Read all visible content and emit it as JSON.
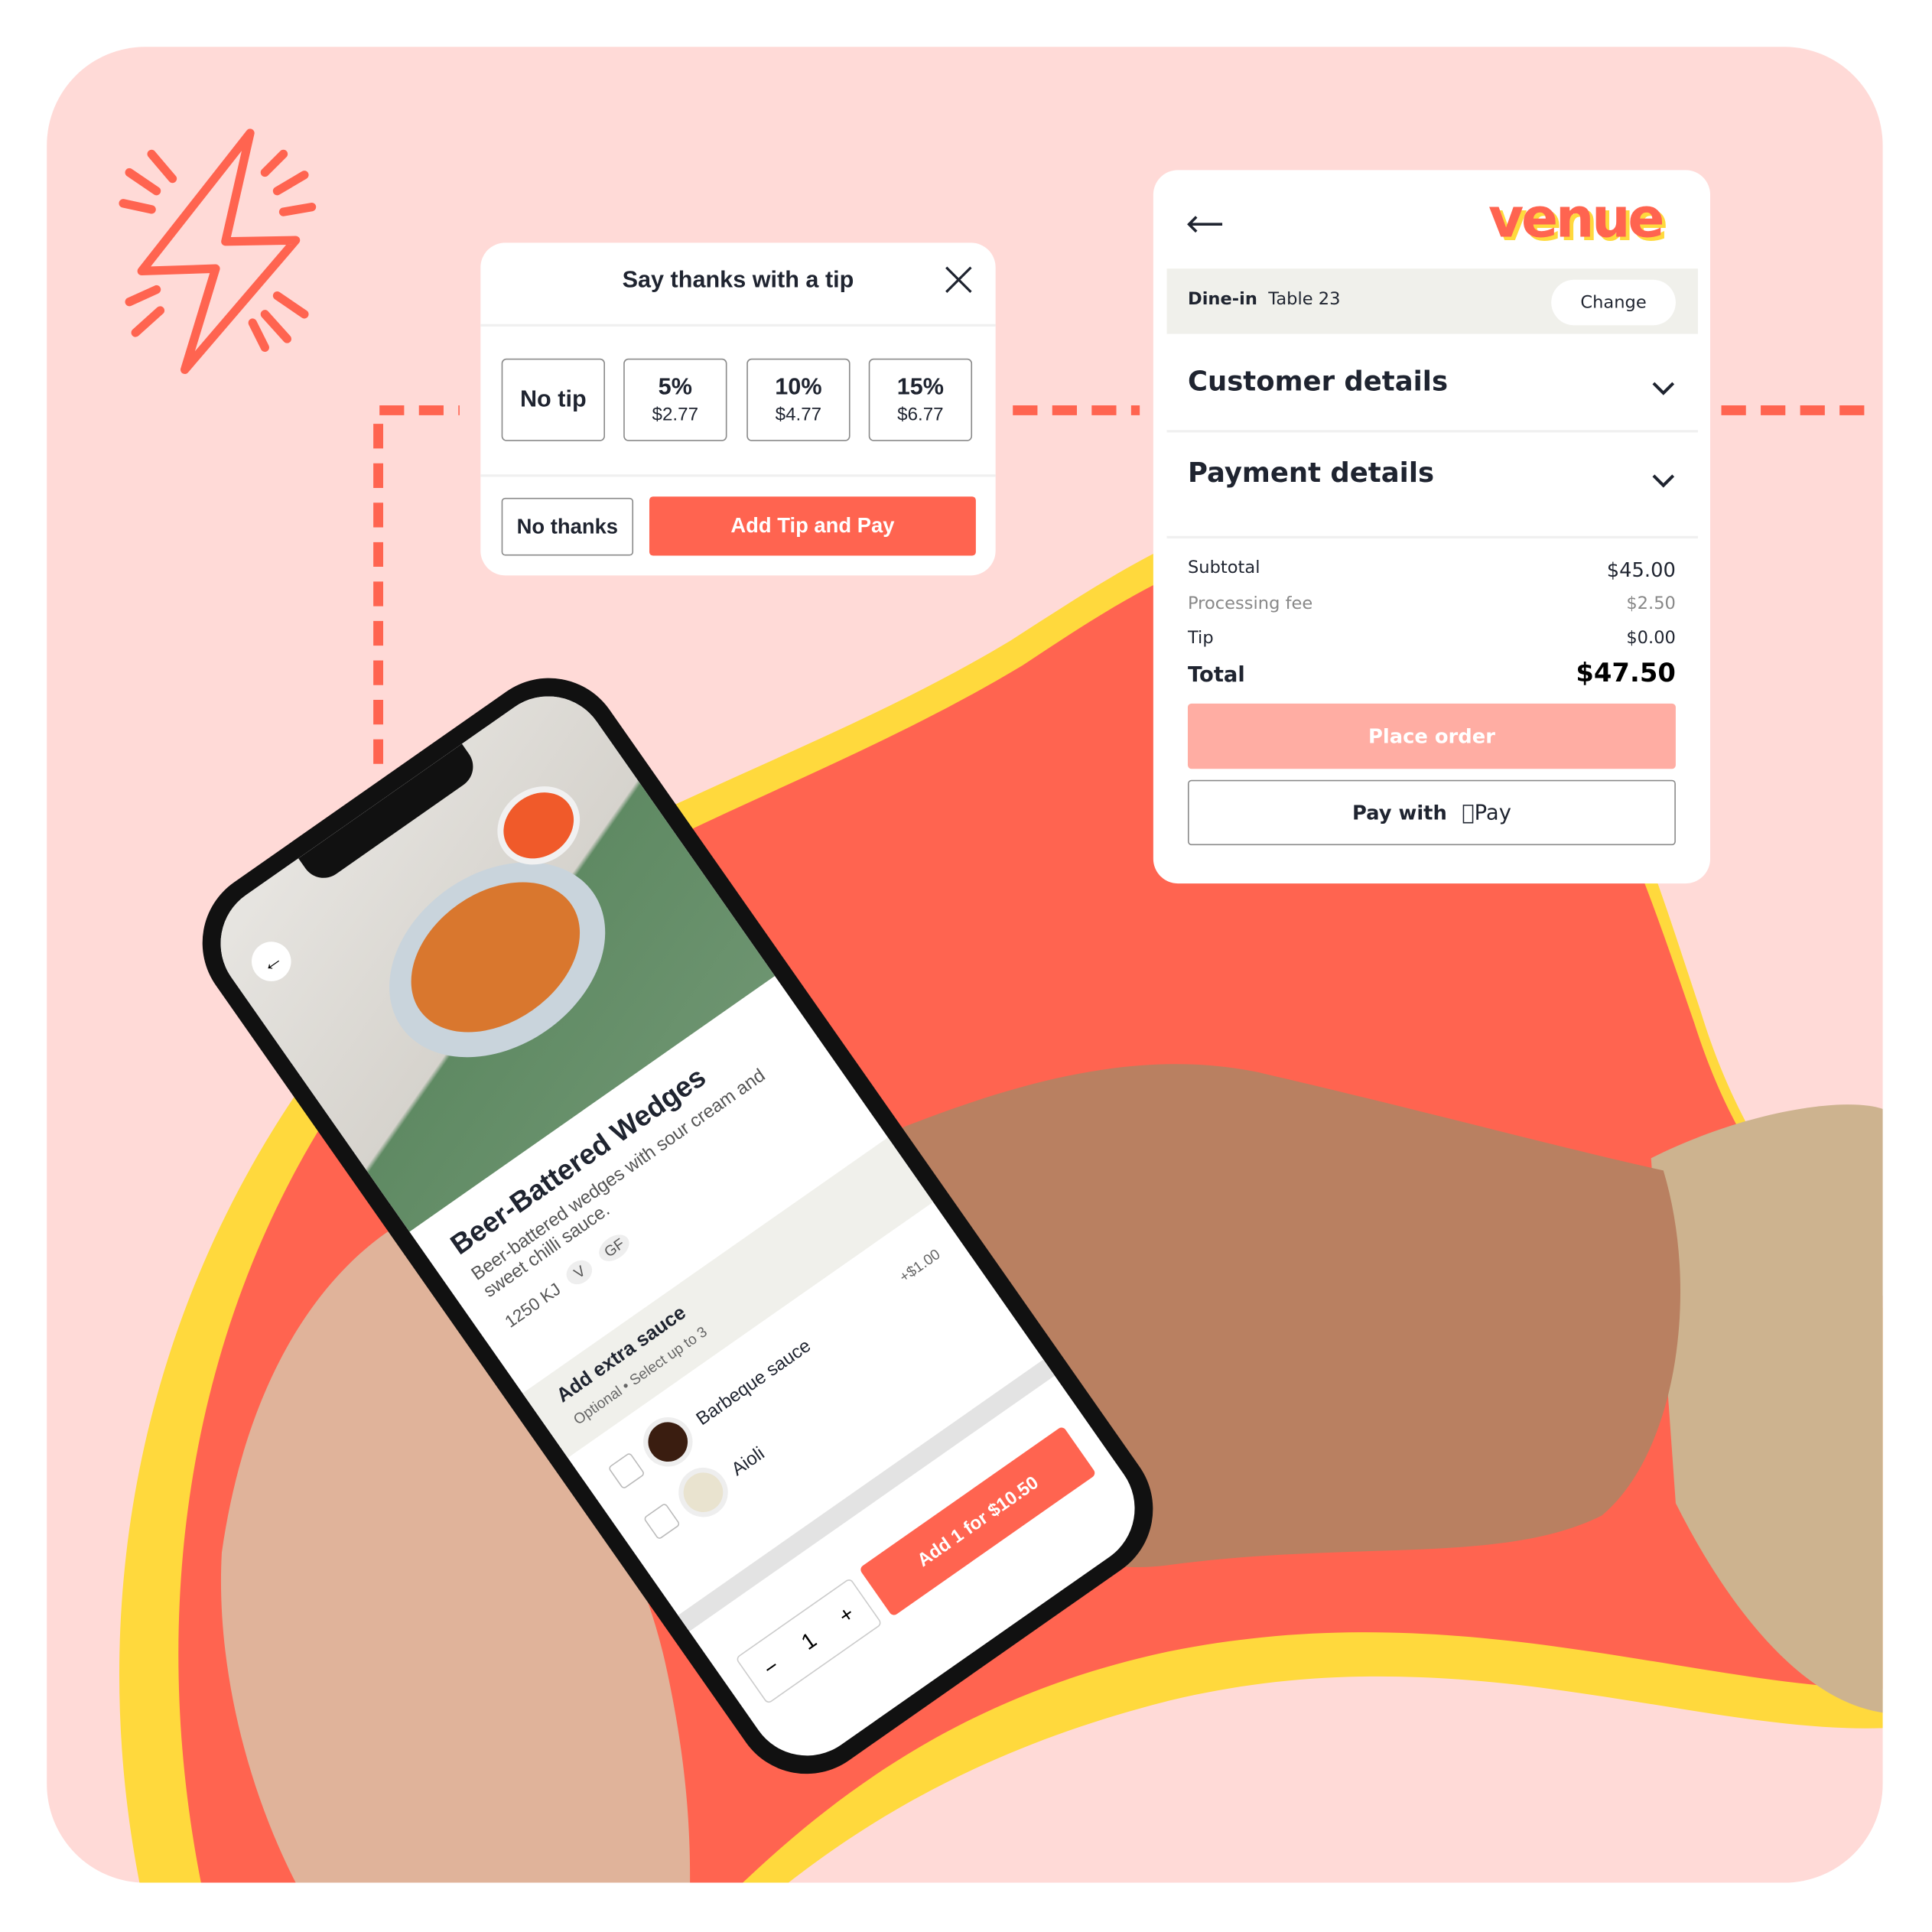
{
  "colors": {
    "accent": "#FF6450",
    "panel": "#FFDAD7",
    "yellow": "#FFD93D",
    "place_order_disabled": "#FFADA3"
  },
  "tip_modal": {
    "title": "Say thanks with a tip",
    "close_icon": "close-icon",
    "options": [
      {
        "label": "No tip"
      },
      {
        "label": "5%",
        "amount": "$2.77"
      },
      {
        "label": "10%",
        "amount": "$4.77"
      },
      {
        "label": "15%",
        "amount": "$6.77"
      }
    ],
    "no_thanks": "No thanks",
    "add_tip_pay": "Add Tip and Pay"
  },
  "checkout": {
    "logo": "venue",
    "back_icon": "arrow-left-icon",
    "dine_mode": "Dine-in",
    "table": "Table 23",
    "change": "Change",
    "customer_details": "Customer details",
    "payment_details": "Payment details",
    "summary": [
      {
        "label": "Subtotal",
        "value": "$45.00"
      },
      {
        "label": "Processing fee",
        "value": "$2.50"
      },
      {
        "label": "Tip",
        "value": "$0.00"
      },
      {
        "label": "Total",
        "value": "$47.50"
      }
    ],
    "place_order": "Place order",
    "pay_with": "Pay with",
    "apple_pay": "Pay"
  },
  "phone": {
    "item_title": "Beer-Battered Wedges",
    "item_desc": "Beer-battered wedges with sour cream and sweet chilli sauce.",
    "energy": "1250 KJ",
    "tags": [
      "V",
      "GF"
    ],
    "addon_title": "Add extra sauce",
    "addon_sub": "Optional • Select up to 3",
    "addons": [
      {
        "name": "Barbeque sauce",
        "price": "+$1.00"
      },
      {
        "name": "Aioli"
      }
    ],
    "quantity": "1",
    "add_button": "Add 1 for $10.50"
  }
}
